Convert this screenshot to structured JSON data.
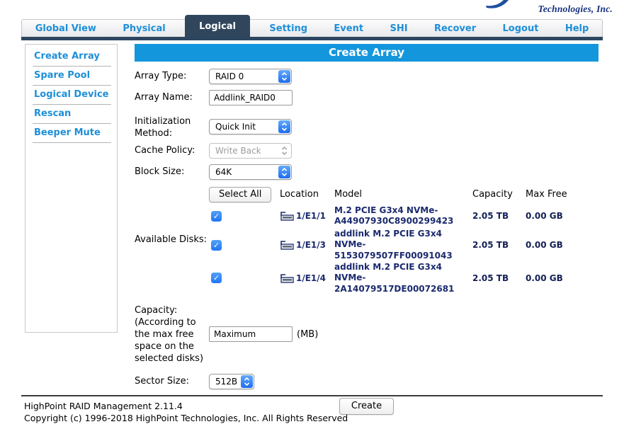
{
  "logo": {
    "tagline": "Technologies, Inc."
  },
  "nav": {
    "tabs": [
      {
        "label": "Global View",
        "active": false
      },
      {
        "label": "Physical",
        "active": false
      },
      {
        "label": "Logical",
        "active": true
      },
      {
        "label": "Setting",
        "active": false
      },
      {
        "label": "Event",
        "active": false
      },
      {
        "label": "SHI",
        "active": false
      },
      {
        "label": "Recover",
        "active": false
      },
      {
        "label": "Logout",
        "active": false
      },
      {
        "label": "Help",
        "active": false
      }
    ]
  },
  "sidebar": {
    "items": [
      {
        "label": "Create Array"
      },
      {
        "label": "Spare Pool"
      },
      {
        "label": "Logical Device"
      },
      {
        "label": "Rescan"
      },
      {
        "label": "Beeper Mute"
      }
    ]
  },
  "main": {
    "title": "Create Array",
    "fields": {
      "array_type": {
        "label": "Array Type:",
        "value": "RAID 0"
      },
      "array_name": {
        "label": "Array Name:",
        "value": "Addlink_RAID0"
      },
      "init_method": {
        "label": "Initialization Method:",
        "value": "Quick Init"
      },
      "cache_policy": {
        "label": "Cache Policy:",
        "value": "Write Back",
        "disabled": true
      },
      "block_size": {
        "label": "Block Size:",
        "value": "64K"
      },
      "available_disks_label": "Available Disks:",
      "capacity": {
        "label": "Capacity:\n(According to\nthe max free\nspace on the\nselected disks)",
        "value": "Maximum",
        "unit": "(MB)"
      },
      "sector_size": {
        "label": "Sector Size:",
        "value": "512B"
      }
    },
    "disk_table": {
      "select_all_label": "Select All",
      "headers": [
        "Location",
        "Model",
        "Capacity",
        "Max Free"
      ],
      "rows": [
        {
          "checked": true,
          "location": "1/E1/1",
          "model": "M.2 PCIE G3x4 NVMe-A44907930C8900299423",
          "capacity": "2.05 TB",
          "max_free": "0.00 GB"
        },
        {
          "checked": true,
          "location": "1/E1/3",
          "model": "addlink M.2 PCIE G3x4 NVMe-5153079507FF00091043",
          "capacity": "2.05 TB",
          "max_free": "0.00 GB"
        },
        {
          "checked": true,
          "location": "1/E1/4",
          "model": "addlink M.2 PCIE G3x4 NVMe-2A14079517DE00072681",
          "capacity": "2.05 TB",
          "max_free": "0.00 GB"
        }
      ]
    },
    "create_button": "Create"
  },
  "footer": {
    "line1": "HighPoint RAID Management 2.11.4",
    "line2": "Copyright (c) 1996-2018 HighPoint Technologies, Inc. All Rights Reserved"
  },
  "icons": {
    "checkmark": "✓",
    "disk": "disk-drive-icon",
    "select_stepper": "up-down-chevrons",
    "logo_swoosh": "highpoint-swoosh"
  },
  "colors": {
    "header_bar": "#1496dc",
    "nav_link": "#1e8fd8",
    "active_tab_bg": "#30465c",
    "navy_text": "#1b2a6e",
    "checkbox_blue": "#2076f5",
    "logo_navy": "#15317e"
  }
}
